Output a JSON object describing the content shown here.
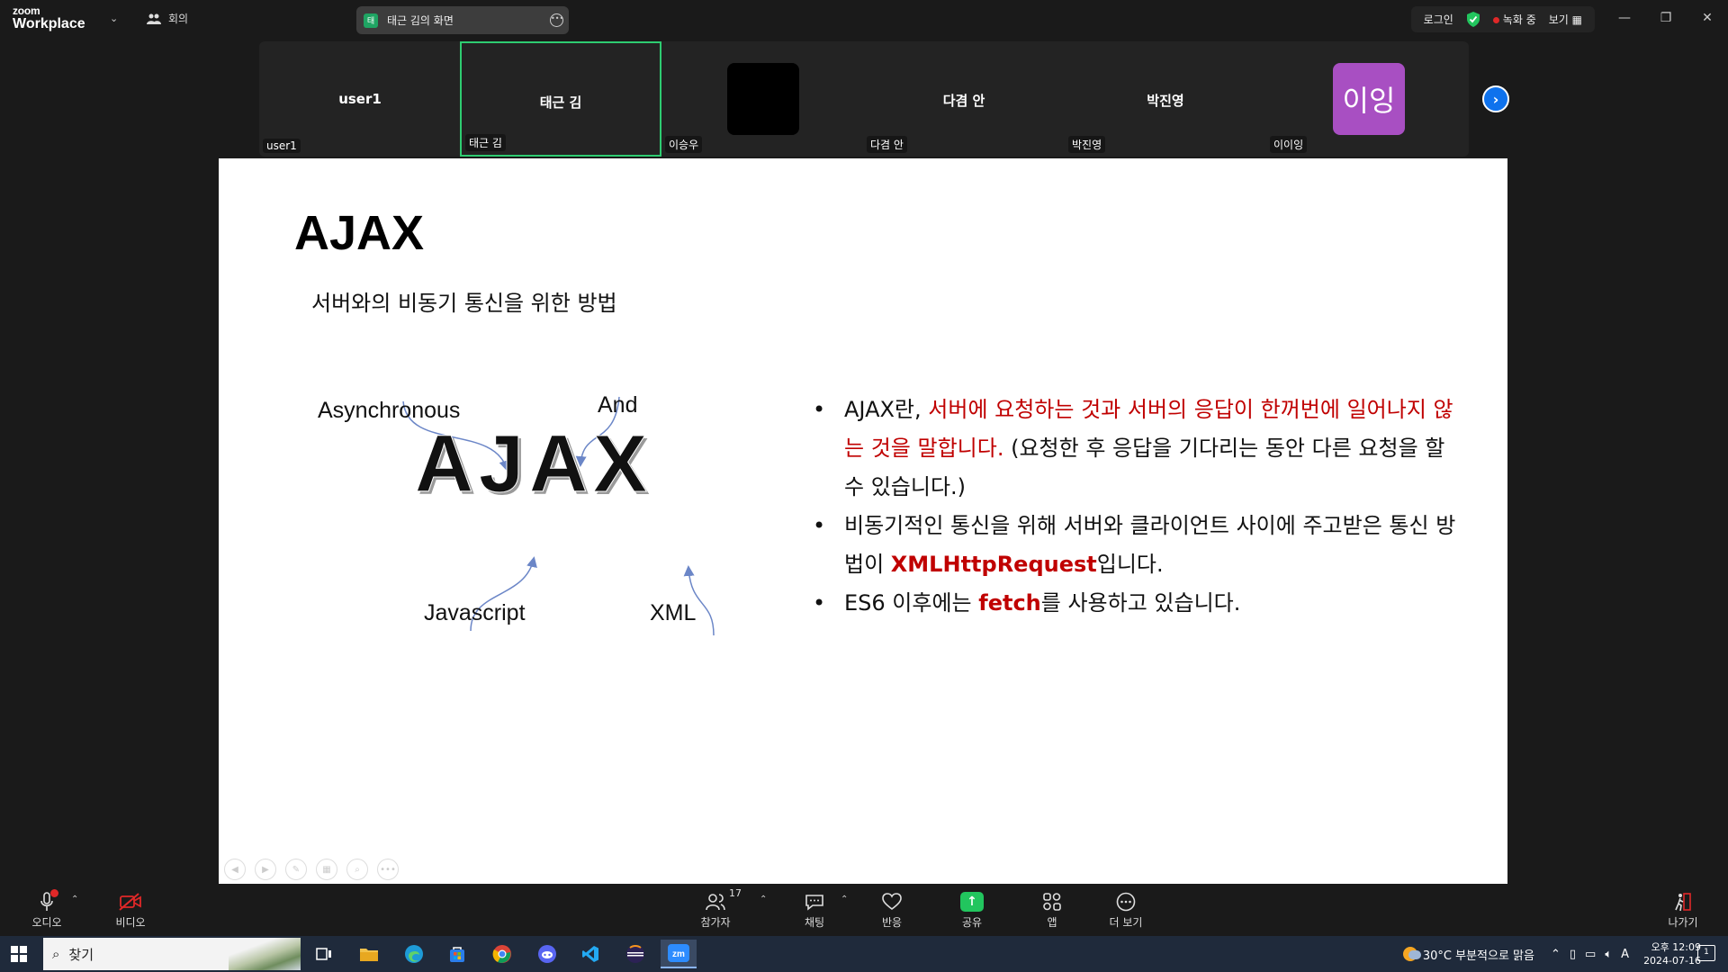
{
  "app": {
    "logo_line1": "zoom",
    "logo_line2": "Workplace",
    "meeting_label": "회의",
    "share_badge": "태",
    "share_title": "태근 김의 화면",
    "login": "로그인",
    "recording": "녹화 중",
    "view": "보기"
  },
  "participants": [
    {
      "center": "user1",
      "corner": "user1"
    },
    {
      "center": "태근 김",
      "corner": "태근 김"
    },
    {
      "center": "",
      "corner": "이승우"
    },
    {
      "center": "다겸 안",
      "corner": "다겸 안"
    },
    {
      "center": "박진영",
      "corner": "박진영"
    },
    {
      "center": "",
      "corner": "이이잉"
    }
  ],
  "avatar_text": "이잉",
  "slide": {
    "title": "AJAX",
    "subtitle": "서버와의 비동기 통신을 위한 방법",
    "diagram": {
      "center": "AJAX",
      "top_left": "Asynchronous",
      "top_right": "And",
      "bottom_left": "Javascript",
      "bottom_right": "XML"
    },
    "bullets": {
      "b1_part1": "AJAX란, ",
      "b1_red": "서버에 요청하는 것과 서버의 응답이 한꺼번에 일어나지 않는 것을 말합니다.",
      "b1_part2": " (요청한 후 응답을 기다리는 동안 다른 요청을 할 수 있습니다.)",
      "b2_part1": "비동기적인 통신을 위해 서버와 클라이언트 사이에 주고받은 통신 방법이 ",
      "b2_bold": "XMLHttpRequest",
      "b2_part2": "입니다.",
      "b3_part1": "ES6 이후에는 ",
      "b3_bold": "fetch",
      "b3_part2": "를 사용하고 있습니다."
    }
  },
  "toolbar": {
    "audio": "오디오",
    "video": "비디오",
    "participants": "참가자",
    "participant_count": "17",
    "chat": "채팅",
    "reactions": "반응",
    "share": "공유",
    "apps": "앱",
    "more": "더 보기",
    "leave": "나가기"
  },
  "taskbar": {
    "search_placeholder": "찾기",
    "weather": "30°C  부분적으로 맑음",
    "time": "오후 12:09",
    "date": "2024-07-16",
    "ime": "A",
    "notif_count": "1"
  },
  "colors": {
    "accent_green": "#2ecc71",
    "slide_red": "#c00000",
    "avatar_purple": "#a84fc2",
    "zoom_blue": "#0e72ed"
  }
}
